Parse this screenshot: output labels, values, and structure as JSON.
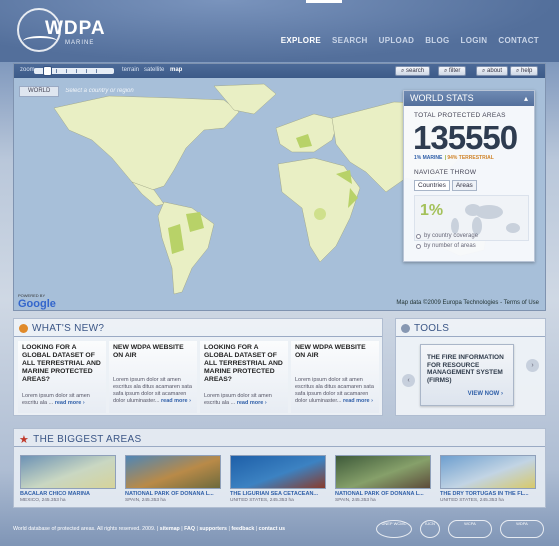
{
  "brand": {
    "name": "WDPA",
    "sub": "MARINE"
  },
  "nav": [
    "EXPLORE",
    "SEARCH",
    "UPLOAD",
    "BLOG",
    "LOGIN",
    "CONTACT"
  ],
  "map": {
    "zoom_label": "zoom",
    "types": [
      "terrain",
      "satellite",
      "map"
    ],
    "buttons": [
      "search",
      "filter",
      "about",
      "help"
    ],
    "breadcrumb": "WORLD",
    "breadcrumb_hint": "Select a country or region",
    "google": "Google",
    "google_small": "POWERED BY",
    "credit": "Map data ©2009  Europa Technologies - Terms of Use"
  },
  "stats": {
    "title": "WORLD STATS",
    "total_label": "TOTAL PROTECTED AREAS",
    "total": "135550",
    "marine": "1% MARINE",
    "terrestrial": "94% TERRESTRIAL",
    "throw_label": "NAVIGATE THROW",
    "tabs": [
      "Countries",
      "Areas"
    ],
    "pct": "1%",
    "radios": [
      "by country coverage",
      "by number of areas"
    ]
  },
  "whatsnew": {
    "title": "WHAT'S NEW?",
    "items": [
      {
        "title": "LOOKING FOR A GLOBAL DATASET OF ALL TERRESTRIAL AND MARINE PROTECTED AREAS?",
        "body": "Lorem ipsum dolor sit amen escritu ala ...",
        "more": "read more ›"
      },
      {
        "title": "NEW WDPA WEBSITE ON AIR",
        "body": "Lorem ipsum dolor sit amen escritus ala ditus acamaren sata safa ipsum dolor sit acamaren dolor uluminaster...",
        "more": "read more ›"
      },
      {
        "title": "LOOKING FOR A GLOBAL DATASET OF ALL TERRESTRIAL AND MARINE PROTECTED AREAS?",
        "body": "Lorem ipsum dolor sit amen escritu ala ...",
        "more": "read more ›"
      },
      {
        "title": "NEW WDPA WEBSITE ON AIR",
        "body": "Lorem ipsum dolor sit amen escritus ala ditus acamaren sata safa ipsum dolor sit acamaren dolor uluminaster...",
        "more": "read more ›"
      }
    ]
  },
  "tools": {
    "title": "TOOLS",
    "card": "THE FIRE INFORMATION FOR RESOURCE MANAGEMENT SYSTEM (FIRMS)",
    "view": "VIEW NOW ›"
  },
  "biggest": {
    "title": "THE BIGGEST AREAS",
    "items": [
      {
        "name": "BACALAR CHICO MARINA",
        "country": "MEXICO, 245.353 ha",
        "colors": [
          "#6d92b5",
          "#c9d7c2",
          "#d6d39a"
        ]
      },
      {
        "name": "NATIONAL PARK OF DOÑANA L...",
        "country": "SPAIN, 245.353 ha",
        "colors": [
          "#4f86b6",
          "#b98a48",
          "#6d6a3d"
        ]
      },
      {
        "name": "THE LIGURIAN SEA CETACEAN...",
        "country": "UNITED STATES, 245.353 ha",
        "colors": [
          "#1e5fa8",
          "#3c82c2",
          "#8a3b2a"
        ]
      },
      {
        "name": "NATIONAL PARK OF DOÑANA L...",
        "country": "SPAIN, 245.353 ha",
        "colors": [
          "#3e5a3a",
          "#86a06a",
          "#5c4b3a"
        ]
      },
      {
        "name": "THE DRY TORTUGAS IN THE FL...",
        "country": "UNITED STATES, 245.353 ha",
        "colors": [
          "#6e9fcf",
          "#c2d4e4",
          "#d7c96a"
        ]
      }
    ]
  },
  "footer": {
    "text": "World database of protected areas. All rights reserved. 2009. |",
    "links": [
      "sitemap",
      "FAQ",
      "supporters",
      "feedback",
      "contact us"
    ]
  },
  "partners": [
    "UNEP WCMC",
    "IUCN",
    "WCPA",
    "WDPA"
  ]
}
